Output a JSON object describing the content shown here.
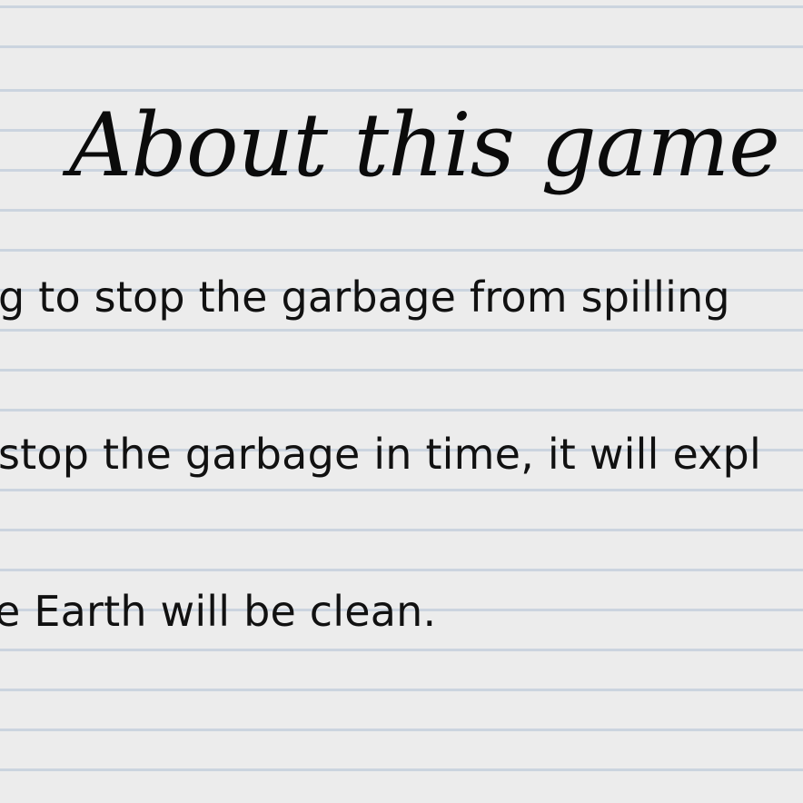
{
  "about_screen": {
    "title": "About this game",
    "lines": [
      "g to stop the garbage from spilling",
      "stop the garbage in time, it will expl",
      "e Earth will be clean."
    ]
  },
  "colors": {
    "paper": "#ececec",
    "rule_line": "#cbd4df",
    "ink": "#111111"
  }
}
